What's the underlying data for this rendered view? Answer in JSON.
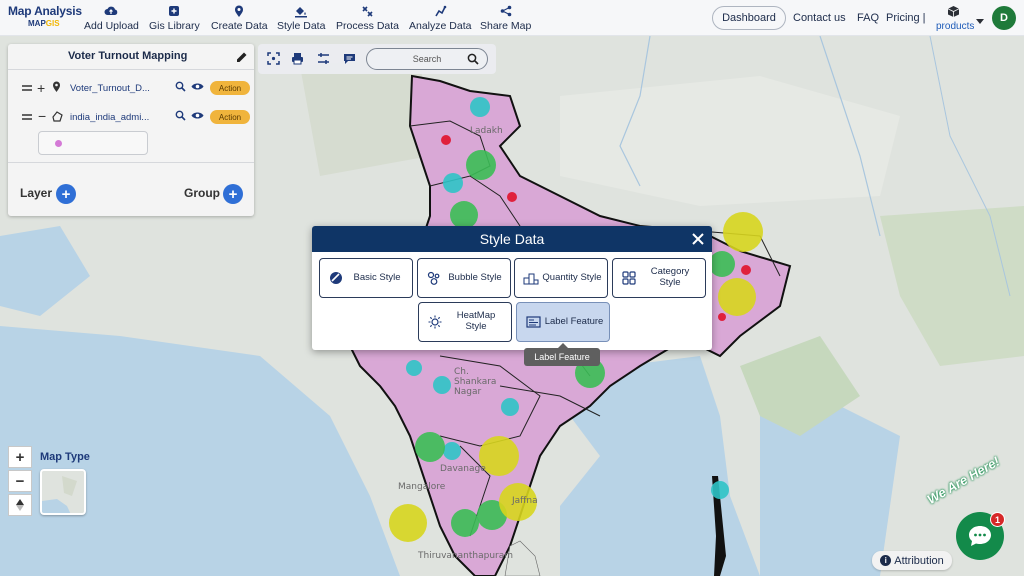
{
  "brand": {
    "title": "Map Analysis",
    "sub_prefix": "MAP",
    "sub_suffix": "GIS"
  },
  "nav": {
    "items": [
      {
        "label": "Add Upload",
        "icon": "cloud-upload-icon"
      },
      {
        "label": "Gis Library",
        "icon": "library-plus-icon"
      },
      {
        "label": "Create Data",
        "icon": "map-pin-icon"
      },
      {
        "label": "Style Data",
        "icon": "paint-bucket-icon"
      },
      {
        "label": "Process Data",
        "icon": "process-icon"
      },
      {
        "label": "Analyze Data",
        "icon": "analyze-icon"
      },
      {
        "label": "Share Map",
        "icon": "share-icon"
      }
    ],
    "dashboard": "Dashboard",
    "contact": "Contact us",
    "faq": "FAQ",
    "pricing": "Pricing |",
    "products": "products",
    "avatar_initial": "D"
  },
  "layer_panel": {
    "title": "Voter Turnout Mapping",
    "layers": [
      {
        "name": "Voter_Turnout_D...",
        "action": "Action"
      },
      {
        "name": "india_india_admi...",
        "action": "Action"
      }
    ],
    "layer_label": "Layer",
    "group_label": "Group"
  },
  "toolstrip": {
    "search_placeholder": "Search"
  },
  "map": {
    "map_type_label": "Map Type",
    "labels": [
      "Ladakh",
      "Ch. Shankara Nagar",
      "Davanage",
      "Mangalore",
      "Thiruvananthapuram",
      "Jaffna"
    ]
  },
  "modal": {
    "title": "Style Data",
    "buttons": [
      {
        "label": "Basic Style",
        "icon": "basic-style-icon"
      },
      {
        "label": "Bubble Style",
        "icon": "bubble-style-icon"
      },
      {
        "label": "Quantity Style",
        "icon": "quantity-style-icon"
      },
      {
        "label": "Category Style",
        "icon": "category-style-icon"
      },
      {
        "label": "HeatMap Style",
        "icon": "heatmap-style-icon"
      },
      {
        "label": "Label Feature",
        "icon": "label-feature-icon"
      }
    ],
    "tooltip": "Label Feature"
  },
  "bottom": {
    "attribution": "Attribution",
    "we_are_here": "We Are Here!",
    "chat_badge": "1"
  },
  "colors": {
    "navy": "#0f3566",
    "accent_blue": "#2f6fd6",
    "action_orange": "#f0b43c",
    "india_fill": "#d9a8d6",
    "chat_green": "#138a4a"
  }
}
